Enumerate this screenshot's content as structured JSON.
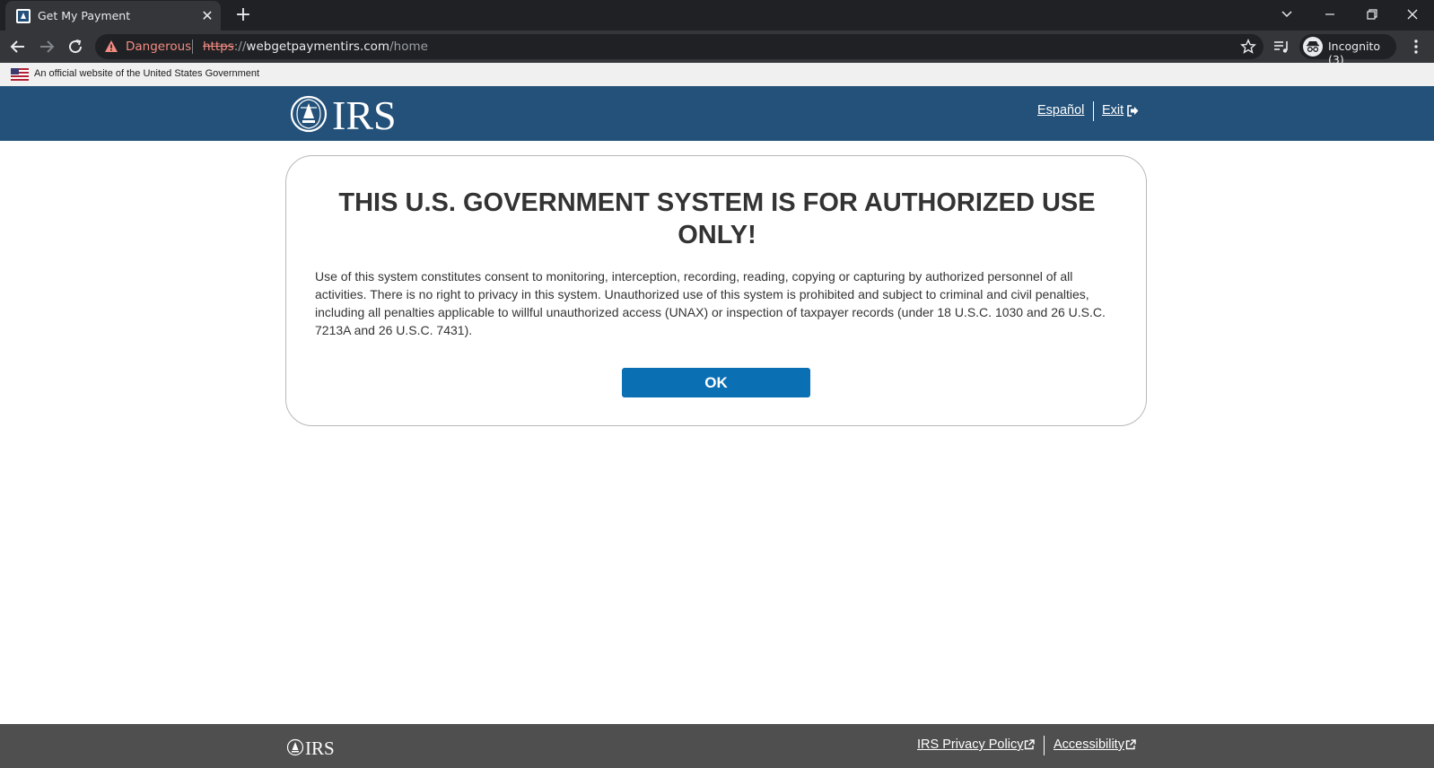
{
  "browser": {
    "tab_title": "Get My Payment",
    "tab_close_glyph": "✕",
    "new_tab_glyph": "+",
    "security_label": "Dangerous",
    "url_scheme": "https",
    "url_sep": "://",
    "url_host": "webgetpaymentirs.com",
    "url_path": "/home",
    "profile_label": "Incognito (3)",
    "icons": [
      "back-icon",
      "forward-icon",
      "reload-icon",
      "warning-icon",
      "star-icon",
      "reading-list-icon",
      "incognito-icon",
      "menu-icon",
      "minimize-icon",
      "restore-icon",
      "close-icon"
    ],
    "colors": {
      "chrome_dark": "#202124",
      "chrome_mid": "#35363a",
      "danger": "#f28b82"
    }
  },
  "gov_banner": {
    "text": "An official website of the United States Government"
  },
  "header": {
    "logo_text": "IRS",
    "language_link": "Español",
    "exit_link": "Exit",
    "background": "#23517a"
  },
  "modal": {
    "title": "THIS U.S. GOVERNMENT SYSTEM IS FOR AUTHORIZED USE ONLY!",
    "body": "Use of this system constitutes consent to monitoring, interception, recording, reading, copying or capturing by authorized personnel of all activities. There is no right to privacy in this system. Unauthorized use of this system is prohibited and subject to criminal and civil penalties, including all penalties applicable to willful unauthorized access (UNAX) or inspection of taxpayer records (under 18 U.S.C. 1030 and 26 U.S.C. 7213A and 26 U.S.C. 7431).",
    "ok_label": "OK",
    "button_color": "#0b6fb3"
  },
  "footer": {
    "logo_text": "IRS",
    "privacy_link": "IRS Privacy Policy",
    "accessibility_link": "Accessibility",
    "background": "#4f4f4f"
  }
}
